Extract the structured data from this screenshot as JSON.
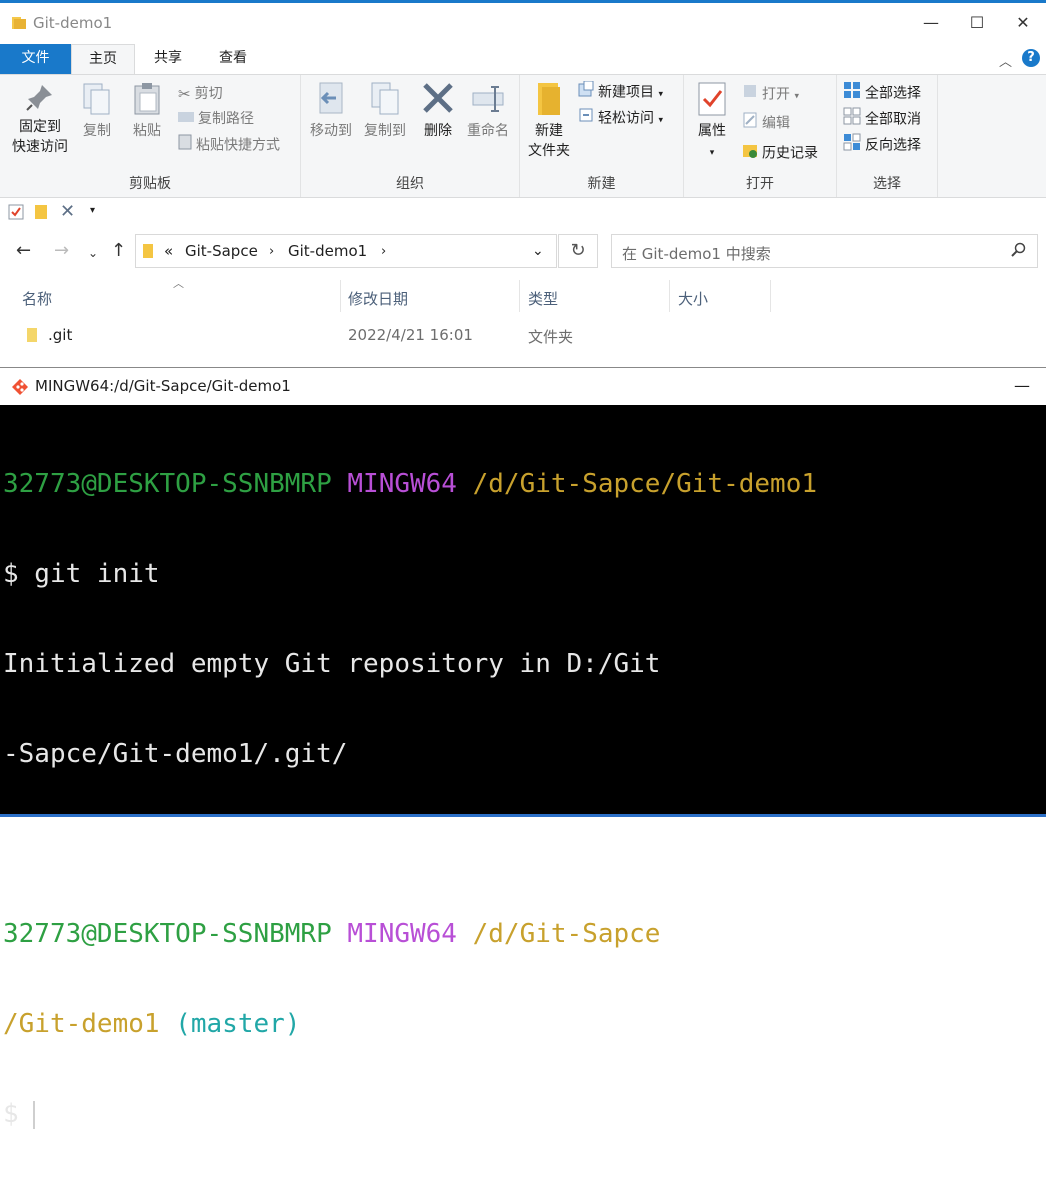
{
  "window": {
    "title": "Git-demo1"
  },
  "ribbon": {
    "tabs": {
      "file": "文件",
      "home": "主页",
      "share": "共享",
      "view": "查看"
    },
    "clipboard": {
      "pin": "固定到",
      "pin2": "快速访问",
      "copy": "复制",
      "paste": "粘贴",
      "cut": "剪切",
      "copy_path": "复制路径",
      "paste_shortcut": "粘贴快捷方式",
      "label": "剪贴板"
    },
    "organize": {
      "move_to": "移动到",
      "copy_to": "复制到",
      "delete": "删除",
      "rename": "重命名",
      "label": "组织"
    },
    "new": {
      "new_folder": "新建",
      "new_folder2": "文件夹",
      "new_item": "新建项目",
      "easy_access": "轻松访问",
      "label": "新建"
    },
    "open": {
      "properties": "属性",
      "open": "打开",
      "edit": "编辑",
      "history": "历史记录",
      "label": "打开"
    },
    "select": {
      "select_all": "全部选择",
      "select_none": "全部取消",
      "invert": "反向选择",
      "label": "选择"
    }
  },
  "address": {
    "chevron": "«",
    "crumbs": [
      "Git-Sapce",
      "Git-demo1"
    ],
    "search_placeholder": "在 Git-demo1 中搜索"
  },
  "columns": {
    "name": "名称",
    "modified": "修改日期",
    "type": "类型",
    "size": "大小"
  },
  "files": [
    {
      "name": ".git",
      "modified": "2022/4/21 16:01",
      "type": "文件夹"
    }
  ],
  "terminal": {
    "title": "MINGW64:/d/Git-Sapce/Git-demo1",
    "lines": {
      "l1_user": "32773@DESKTOP-SSNBMRP",
      "l1_sys": "MINGW64",
      "l1_path": "/d/Git-Sapce/Git-demo1",
      "l2": "$ git init",
      "l3": "Initialized empty Git repository in D:/Git",
      "l4": "-Sapce/Git-demo1/.git/",
      "l6_user": "32773@DESKTOP-SSNBMRP",
      "l6_sys": "MINGW64",
      "l6_path": "/d/Git-Sapce",
      "l7_path": "/Git-demo1",
      "l7_branch": "(master)",
      "l8": "$"
    }
  },
  "colors": {
    "accent": "#1979ca",
    "term_user": "#2ea043",
    "term_sys": "#b84fd6",
    "term_path": "#c8a12d",
    "term_branch": "#21a7a7"
  }
}
